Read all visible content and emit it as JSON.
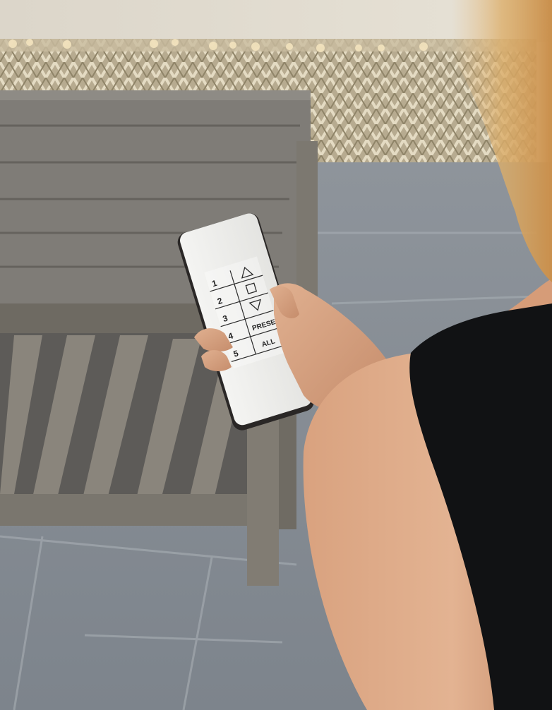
{
  "remote": {
    "channels": [
      {
        "number": "1",
        "function": "up-arrow"
      },
      {
        "number": "2",
        "function": "stop-square"
      },
      {
        "number": "3",
        "function": "down-arrow"
      },
      {
        "number": "4",
        "label": "PRESET"
      },
      {
        "number": "5",
        "label": "ALL"
      }
    ]
  },
  "colors": {
    "stone_floor": "#8a9097",
    "teak_table": "#7b7770",
    "wicker": "#b9ad90",
    "remote_body": "#eeeeec",
    "remote_edge": "#2a2726",
    "skin": "#d8a483",
    "top": "#111214",
    "hair": "#d9a860"
  }
}
